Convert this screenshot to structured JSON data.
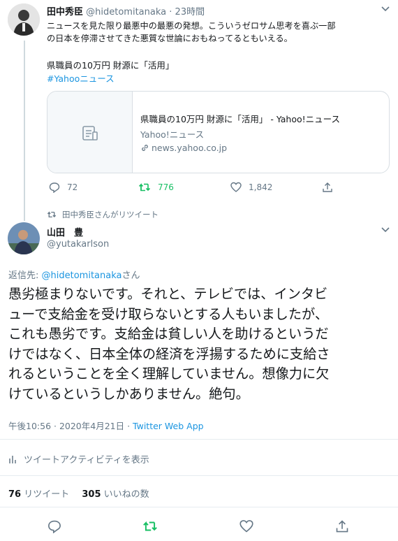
{
  "tweet1": {
    "author_name": "田中秀臣",
    "handle": "@hidetomitanaka",
    "separator": "·",
    "time": "23時間",
    "text_line1": "ニュースを見た限り最悪中の最悪の発想。こういうゼロサム思考を喜ぶ一部",
    "text_line2": "の日本を停滞させてきた悪質な世論におもねってるともいえる。",
    "headline": "県職員の10万円 財源に「活用」",
    "hashtag": "#Yahooニュース",
    "card": {
      "title": "県職員の10万円 財源に「活用」 - Yahoo!ニュース",
      "source": "Yahoo!ニュース",
      "domain": "news.yahoo.co.jp"
    },
    "actions": {
      "replies": "72",
      "retweets": "776",
      "likes": "1,842"
    }
  },
  "retweet_notice": "田中秀臣さんがリツイート",
  "tweet2": {
    "author_name": "山田　豊",
    "handle": "@yutakarlson",
    "reply_prefix": "返信先: ",
    "reply_to": "@hidetomitanaka",
    "reply_suffix": "さん",
    "body_lines": [
      "愚劣極まりないです。それと、テレビでは、インタビ",
      "ューで支給金を受け取らないとする人もいましたが、",
      "これも愚劣です。支給金は貧しい人を助けるというだ",
      "けではなく、日本全体の経済を浮揚するために支給さ",
      "れるということを全く理解していません。想像力に欠",
      "けているというしかありません。絶句。"
    ],
    "timestamp": "午後10:56 · 2020年4月21日 · ",
    "client": "Twitter Web App",
    "activity_label": "ツイートアクティビティを表示",
    "retweet_count": "76",
    "retweet_label": "リツイート",
    "like_count": "305",
    "like_label": "いいねの数"
  },
  "colors": {
    "link": "#1b95e0",
    "retweet_green": "#17bf63",
    "muted": "#657786"
  },
  "icons": [
    "chevron-down-icon",
    "document-icon",
    "link-icon",
    "reply-icon",
    "retweet-icon",
    "heart-icon",
    "share-icon",
    "bar-chart-icon"
  ]
}
